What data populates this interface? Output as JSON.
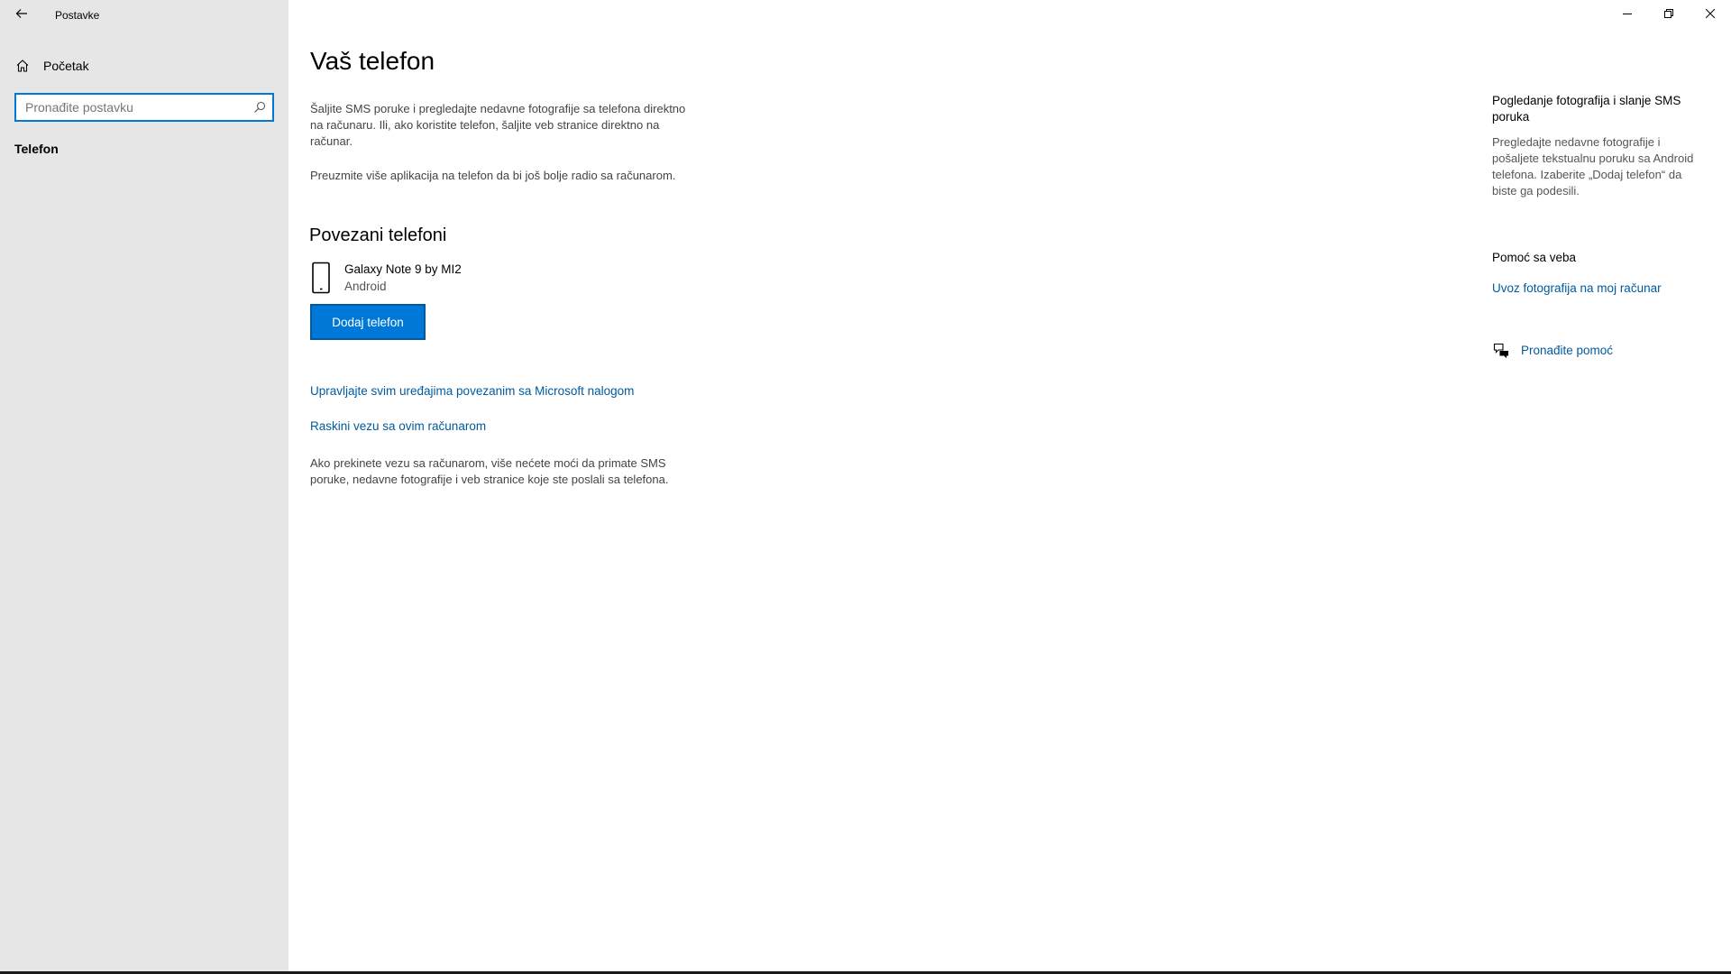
{
  "app": {
    "title": "Postavke"
  },
  "sidebar": {
    "home_label": "Početak",
    "search_placeholder": "Pronađite postavku",
    "search_value": "",
    "section_label": "Telefon"
  },
  "main": {
    "title": "Vaš telefon",
    "description": "Šaljite SMS poruke i pregledajte nedavne fotografije sa telefona direktno na računaru. Ili, ako koristite telefon, šaljite veb stranice direktno na računar.",
    "apps_note": "Preuzmite više aplikacija na telefon da bi još bolje radio sa računarom.",
    "linked_title": "Povezani telefoni",
    "device": {
      "name": "Galaxy Note 9 by MI2",
      "os": "Android"
    },
    "add_button_label": "Dodaj telefon",
    "manage_link": "Upravljajte svim uređajima povezanim sa Microsoft nalogom",
    "disconnect_link": "Raskini vezu sa ovim računarom",
    "disconnect_note": "Ako prekinete vezu sa računarom, više nećete moći da primate SMS poruke, nedavne fotografije i veb stranice koje ste poslali sa telefona."
  },
  "right_pane": {
    "heading": "Pogledanje fotografija i slanje SMS poruka",
    "description": "Pregledajte nedavne fotografije i pošaljete tekstualnu poruku sa Android telefona. Izaberite „Dodaj telefon“ da biste ga podesili.",
    "help_heading": "Pomoć sa veba",
    "help_link": "Uvoz fotografija na moj računar",
    "find_help_label": "Pronađite pomoć"
  },
  "icons": {
    "back": "back-arrow-icon",
    "home": "home-icon",
    "search": "search-icon",
    "phone": "phone-icon",
    "chat": "chat-icon",
    "minimize": "minimize-icon",
    "restore": "restore-icon",
    "close": "close-icon"
  },
  "colors": {
    "accent": "#0078d7",
    "link": "#005a9e",
    "sidebar_bg": "#e6e6e6"
  }
}
